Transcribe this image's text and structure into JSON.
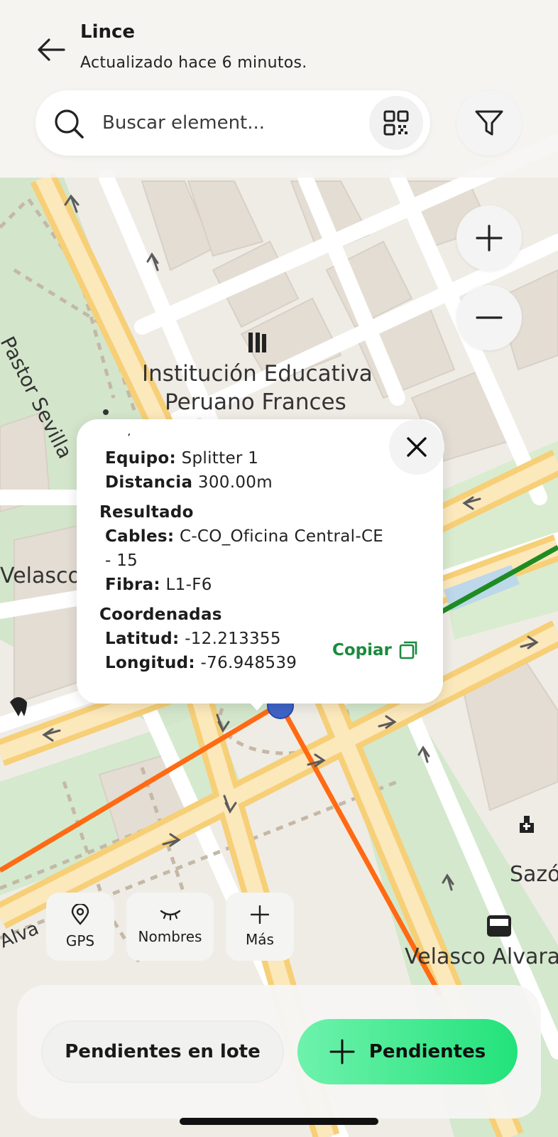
{
  "header": {
    "title": "Lince",
    "subtitle": "Actualizado hace 6 minutos."
  },
  "search": {
    "placeholder": "Buscar element..."
  },
  "map": {
    "labels": [
      "Institución Educativa",
      "Peruano Frances",
      "Pastor Sevilla",
      "Velasco",
      "Sazó",
      "Velasco Alvara",
      "Alva"
    ],
    "line_colors": {
      "orange": "#ff6a13",
      "green": "#1e8c22"
    }
  },
  "popup": {
    "equipo_label": "Equipo:",
    "equipo_value": "Splitter 1",
    "distancia_label": "Distancia",
    "distancia_value": "300.00m",
    "resultado_title": "Resultado",
    "cables_label": "Cables:",
    "cables_value_1": "C-CO_Oficina Central-CE",
    "cables_value_2": "- 15",
    "fibra_label": "Fibra:",
    "fibra_value": "L1-F6",
    "coordenadas_title": "Coordenadas",
    "latitud_label": "Latitud:",
    "latitud_value": "-12.213355",
    "longitud_label": "Longitud:",
    "longitud_value": "-76.948539",
    "copy_label": "Copiar"
  },
  "chips": [
    {
      "label": "GPS",
      "icon": "location-pin-icon"
    },
    {
      "label": "Nombres",
      "icon": "eye-closed-icon"
    },
    {
      "label": "Más",
      "icon": "plus-icon"
    }
  ],
  "actions": {
    "batch_label": "Pendientes en lote",
    "pending_label": "Pendientes"
  },
  "colors": {
    "accent_green": "#22e27a",
    "copy_green": "#1b8a3e"
  }
}
